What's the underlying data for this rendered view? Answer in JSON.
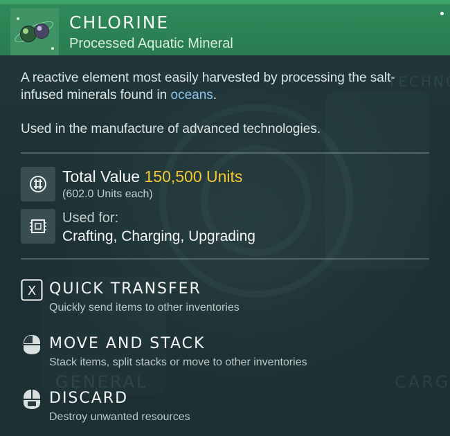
{
  "item": {
    "name": "CHLORINE",
    "category": "Processed Aquatic Mineral",
    "icon": "chlorine-molecule-icon",
    "header_color": "#2f8a5a"
  },
  "description": {
    "line1_before_link": "A reactive element most easily harvested by processing the salt-infused minerals found in ",
    "link": "oceans",
    "line1_after_link": ".",
    "line2": "Used in the manufacture of advanced technologies."
  },
  "value": {
    "label": "Total Value",
    "amount": "150,500 Units",
    "each": "(602.0 Units each)",
    "icon": "currency-units-icon",
    "accent": "#f5c832"
  },
  "usage": {
    "label": "Used for:",
    "value": "Crafting, Charging, Upgrading",
    "icon": "circuit-chip-icon"
  },
  "actions": [
    {
      "name": "QUICK TRANSFER",
      "description": "Quickly send items to other inventories",
      "key": "X",
      "icon": "x-key-icon"
    },
    {
      "name": "MOVE AND STACK",
      "description": "Stack items, split stacks or move to other inventories",
      "icon": "mouse-left-click-icon"
    },
    {
      "name": "DISCARD",
      "description": "Destroy unwanted resources",
      "icon": "mouse-hold-icon"
    }
  ],
  "background_labels": {
    "top_right": "TECHNOL",
    "bottom_left": "GENERAL",
    "bottom_right": "CARGO"
  }
}
